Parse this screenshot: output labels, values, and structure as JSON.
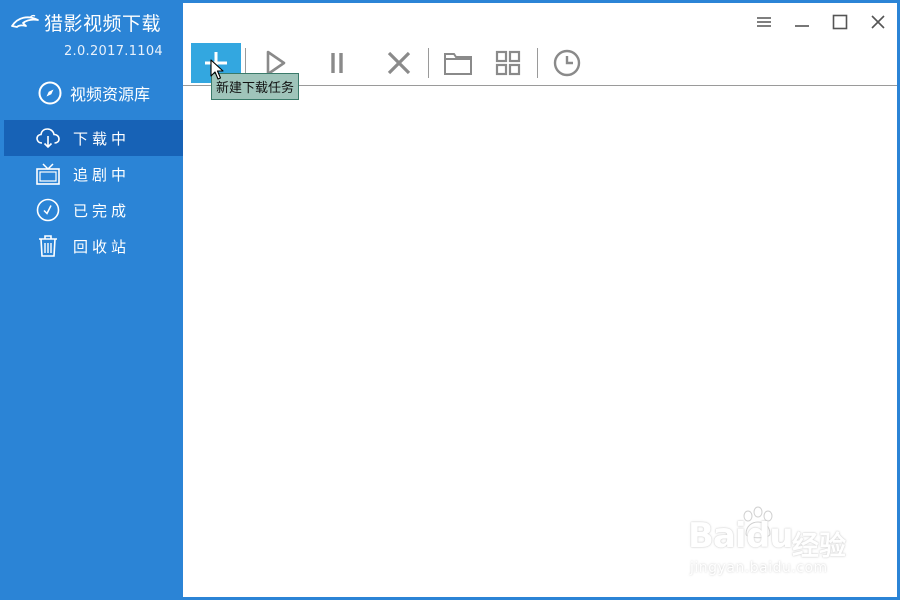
{
  "app": {
    "title": "猎影视频下载",
    "version": "2.0.2017.1104"
  },
  "sidebar": {
    "library_label": "视频资源库",
    "items": [
      {
        "label": "下载中",
        "icon": "cloud-download-icon",
        "active": true
      },
      {
        "label": "追剧中",
        "icon": "tv-icon",
        "active": false
      },
      {
        "label": "已完成",
        "icon": "check-circle-icon",
        "active": false
      },
      {
        "label": "回收站",
        "icon": "trash-icon",
        "active": false
      }
    ]
  },
  "toolbar": {
    "tooltip": "新建下载任务",
    "buttons": [
      "add-icon",
      "play-icon",
      "pause-icon",
      "close-icon",
      "folder-icon",
      "grid-icon",
      "clock-icon"
    ]
  },
  "window_controls": [
    "menu-icon",
    "minimize-icon",
    "maximize-icon",
    "close-icon"
  ],
  "watermark": {
    "brand_left": "Bai",
    "brand_right": "du",
    "brand_cn": "经验",
    "url": "jingyan.baidu.com"
  },
  "colors": {
    "sidebar_bg": "#2b84d6",
    "sidebar_active": "#1762b6",
    "add_button": "#33a7e0",
    "tooltip_bg": "#9fc4ba",
    "icon_gray": "#8a8a8a"
  }
}
